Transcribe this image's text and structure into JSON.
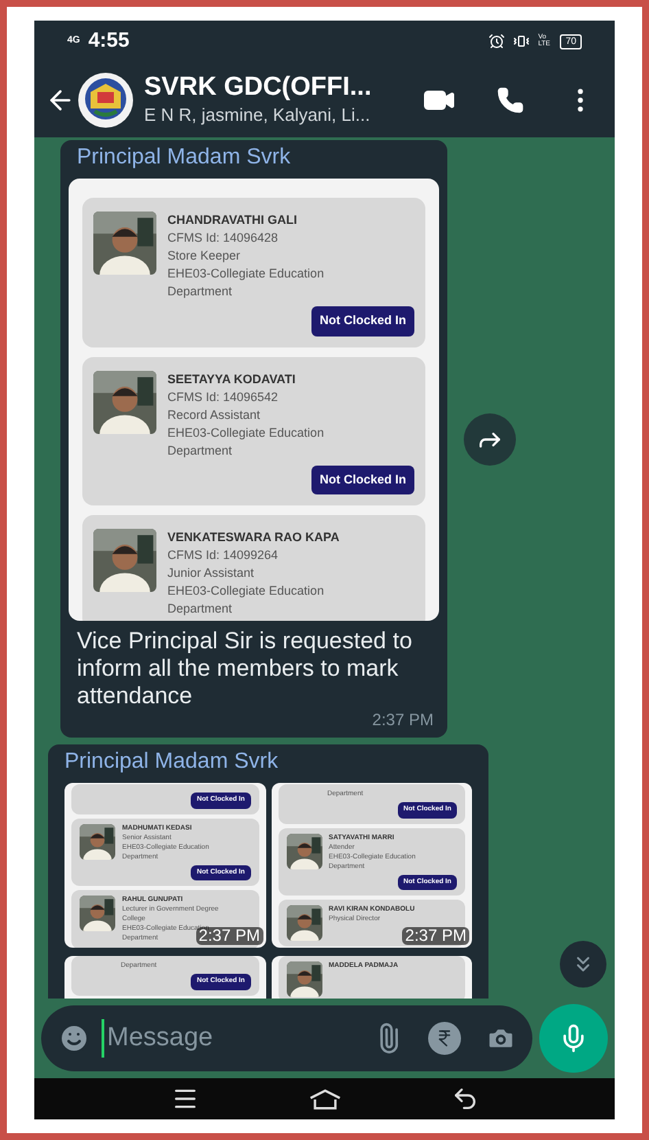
{
  "status_bar": {
    "network": "4G",
    "time": "4:55",
    "volte": "Vo LTE",
    "battery": "70"
  },
  "header": {
    "title": "SVRK GDC(OFFI...",
    "subtitle": "E N R, jasmine, Kalyani, Li..."
  },
  "messages": [
    {
      "kind": "cards",
      "sender": "Principal Madam Svrk",
      "cards": [
        {
          "name": "CHANDRAVATHI GALI",
          "id": "CFMS Id: 14096428",
          "role": "Store Keeper",
          "department": [
            "EHE03-Collegiate Education",
            "Department"
          ],
          "status": "Not Clocked In"
        },
        {
          "name": "SEETAYYA KODAVATI",
          "id": "CFMS Id: 14096542",
          "role": "Record Assistant",
          "department": [
            "EHE03-Collegiate Education",
            "Department"
          ],
          "status": "Not Clocked In"
        },
        {
          "name": "VENKATESWARA RAO KAPA",
          "id": "CFMS Id: 14099264",
          "role": "Junior Assistant",
          "department": [
            "EHE03-Collegiate Education",
            "Department"
          ]
        }
      ],
      "caption": "Vice Principal Sir is requested to inform all the members to mark attendance",
      "time": "2:37 PM"
    },
    {
      "kind": "album",
      "sender": "Principal Madam Svrk",
      "rows": [
        {
          "tiles": [
            {
              "time": "2:37 PM",
              "cards": [
                {
                  "status": "Not Clocked In"
                },
                {
                  "name": "MADHUMATI KEDASI",
                  "role": "Senior Assistant",
                  "department": [
                    "EHE03-Collegiate Education",
                    "Department"
                  ],
                  "status": "Not Clocked In"
                },
                {
                  "name": "RAHUL GUNUPATI",
                  "role": "Lecturer in Government Degree",
                  "role_2": "College",
                  "department": [
                    "EHE03-Collegiate Education",
                    "Department"
                  ]
                }
              ]
            },
            {
              "time": "2:37 PM",
              "cards": [
                {
                  "department": [
                    "Department"
                  ],
                  "status": "Not Clocked In"
                },
                {
                  "name": "SATYAVATHI MARRI",
                  "role": "Attender",
                  "department": [
                    "EHE03-Collegiate Education",
                    "Department"
                  ],
                  "status": "Not Clocked In"
                },
                {
                  "name": "RAVI KIRAN KONDABOLU",
                  "role": "Physical Director"
                }
              ]
            }
          ]
        },
        {
          "tiles": [
            {
              "cards": [
                {
                  "department": [
                    "Department"
                  ],
                  "status": "Not Clocked In"
                }
              ]
            },
            {
              "cards": [
                {
                  "name": "MADDELA PADMAJA"
                }
              ]
            }
          ]
        }
      ]
    }
  ],
  "composer": {
    "placeholder": "Message"
  }
}
